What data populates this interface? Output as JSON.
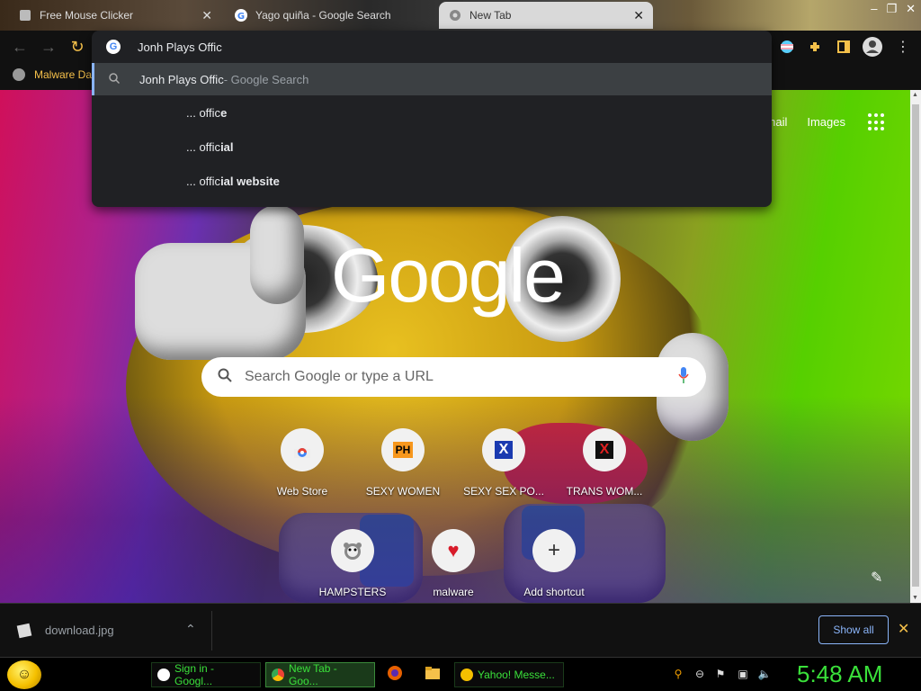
{
  "tabs": [
    {
      "title": "Free Mouse Clicker",
      "active": false
    },
    {
      "title": "Yago quiña - Google Search",
      "active": false
    },
    {
      "title": "New Tab",
      "active": true
    }
  ],
  "omnibox": {
    "input_value": "Jonh Plays Offic",
    "search_row": {
      "query": "Jonh Plays Offic",
      "suffix": " - Google Search"
    },
    "suggestions": [
      {
        "prefix": "... offic",
        "bold": "e"
      },
      {
        "prefix": "... offic",
        "bold": "ial"
      },
      {
        "prefix": "... offic",
        "bold": "ial website"
      }
    ]
  },
  "bookmarks": [
    {
      "label": "Malware Da"
    }
  ],
  "ntp": {
    "links": [
      "mail",
      "Images"
    ],
    "search_placeholder": "Search Google or type a URL",
    "shortcuts_row1": [
      {
        "label": "Web Store",
        "icon": "chrome-webstore-icon"
      },
      {
        "label": "SEXY WOMEN",
        "icon": "ph-icon",
        "icon_text": "PH"
      },
      {
        "label": "SEXY SEX PO...",
        "icon": "x-blue-icon",
        "icon_text": "X"
      },
      {
        "label": "TRANS WOM...",
        "icon": "x-red-icon",
        "icon_text": "X"
      }
    ],
    "shortcuts_row2": [
      {
        "label": "HAMPSTERS",
        "icon": "hamster-icon"
      },
      {
        "label": "malware",
        "icon": "heart-icon",
        "icon_text": "♥"
      },
      {
        "label": "Add shortcut",
        "icon": "plus-icon",
        "icon_text": "+"
      }
    ]
  },
  "downloads": {
    "file": "download.jpg",
    "show_all": "Show all"
  },
  "taskbar": {
    "items": [
      {
        "label": "Sign in - Googl...",
        "active": false
      },
      {
        "label": "New Tab - Goo...",
        "active": true
      },
      {
        "label": "Yahoo! Messe...",
        "active": false
      }
    ],
    "clock": "5:48 AM"
  },
  "colors": {
    "accent_green": "#3ae03a",
    "bookmark_yellow": "#f5c04a",
    "omnibox_bg": "#202124",
    "highlight_row": "#3c4043",
    "link_blue": "#8ab4f8"
  }
}
